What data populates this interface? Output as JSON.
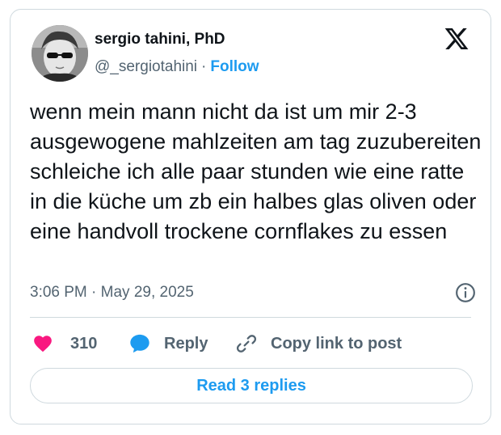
{
  "author": {
    "display_name": "sergio tahini, PhD",
    "handle": "@_sergiotahini",
    "separator": "·",
    "follow_label": "Follow"
  },
  "tweet": {
    "text": "wenn mein mann nicht da ist um mir 2-3 ausgewogene mahlzeiten am tag zuzubereiten schleiche ich alle paar stunden wie eine ratte in die küche um zb ein halbes glas oliven oder eine handvoll trockene cornflakes zu essen",
    "time": "3:06 PM",
    "date_separator": "·",
    "date": "May 29, 2025"
  },
  "actions": {
    "like_count": "310",
    "reply_label": "Reply",
    "copy_link_label": "Copy link to post"
  },
  "replies_button_label": "Read 3 replies",
  "icons": {
    "brand": "x-logo-icon",
    "info": "info-icon",
    "like": "heart-icon",
    "reply": "speech-bubble-icon",
    "copy": "link-icon"
  },
  "colors": {
    "accent": "#1d9bf0",
    "like": "#f91880",
    "secondary_text": "#536471",
    "border": "#cfd9de"
  }
}
